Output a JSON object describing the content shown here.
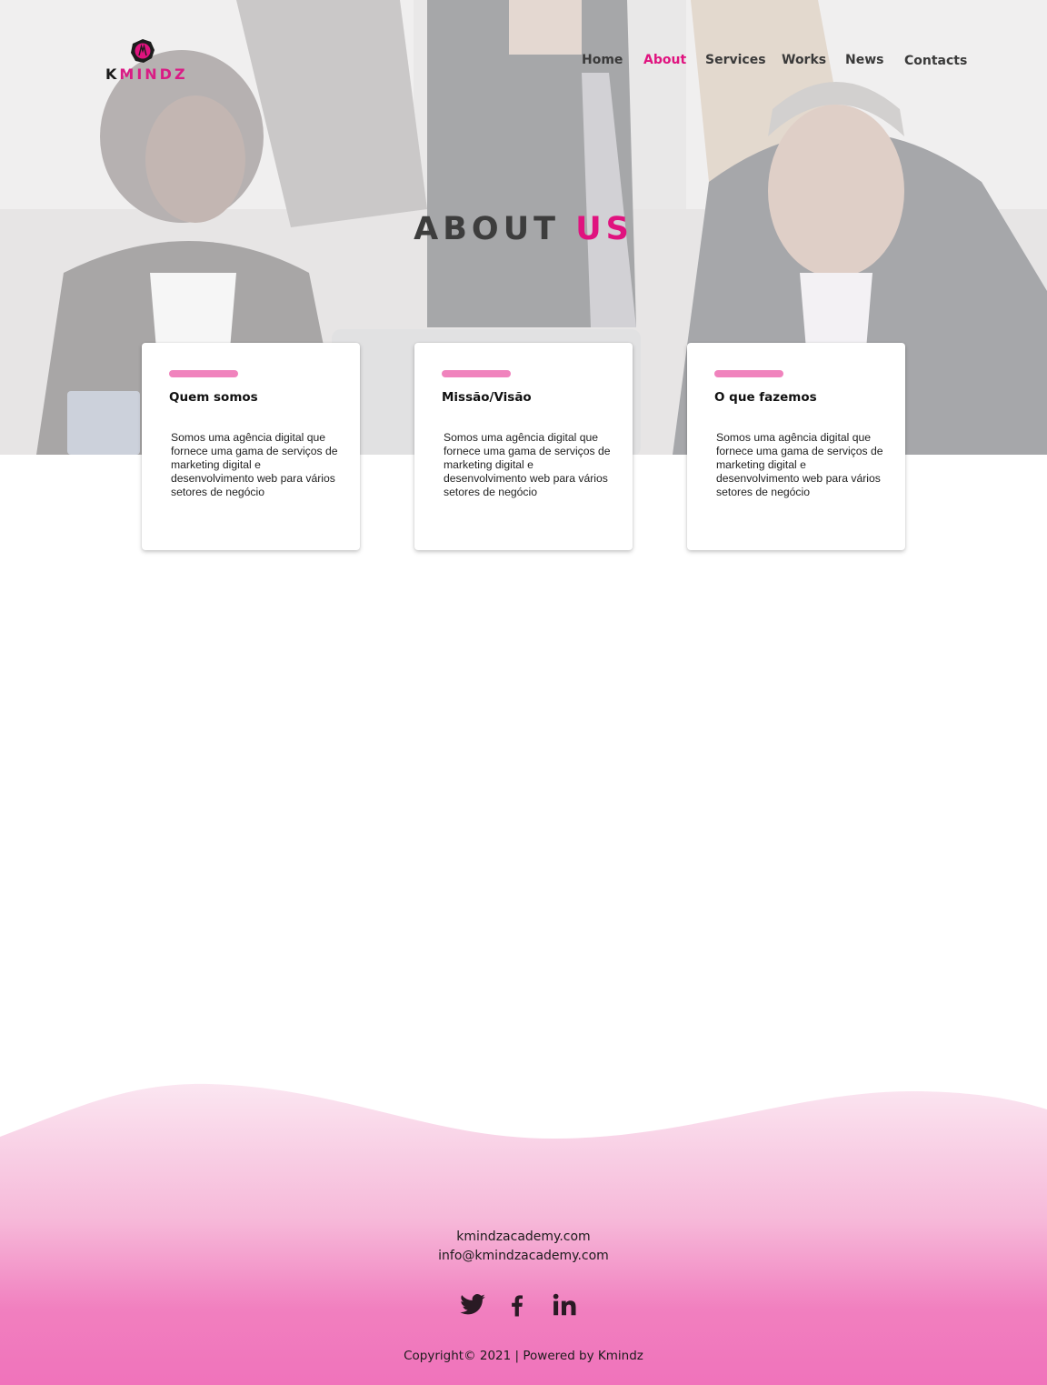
{
  "brand": {
    "logo_letter_k": "K",
    "logo_letters_rest": "MINDZ",
    "accent_color": "#e0137f"
  },
  "nav": {
    "items": [
      {
        "label": "Home",
        "active": false
      },
      {
        "label": "About",
        "active": true
      },
      {
        "label": "Services",
        "active": false
      },
      {
        "label": "Works",
        "active": false
      },
      {
        "label": "News",
        "active": false
      },
      {
        "label": "Contacts",
        "active": false
      }
    ]
  },
  "hero": {
    "title_part1": "ABOUT",
    "title_part2": "US"
  },
  "cards": [
    {
      "title": "Quem somos",
      "text": "Somos uma agência digital que fornece uma gama de serviços de marketing digital e desenvolvimento web para vários setores de negócio"
    },
    {
      "title": "Missão/Visão",
      "text": "Somos uma agência digital que fornece uma gama de serviços de marketing digital e desenvolvimento web para vários setores de negócio"
    },
    {
      "title": "O que fazemos",
      "text": "Somos uma agência digital que fornece uma gama de serviços de marketing digital e desenvolvimento web para vários setores de negócio"
    }
  ],
  "footer": {
    "website": "kmindzacademy.com",
    "email": "info@kmindzacademy.com",
    "socials": [
      {
        "name": "twitter-icon"
      },
      {
        "name": "facebook-icon"
      },
      {
        "name": "linkedin-icon"
      }
    ],
    "copyright": "Copyright© 2021 | Powered by Kmindz",
    "gradient_top": "#fbe6f1",
    "gradient_bottom": "#f075bb"
  }
}
